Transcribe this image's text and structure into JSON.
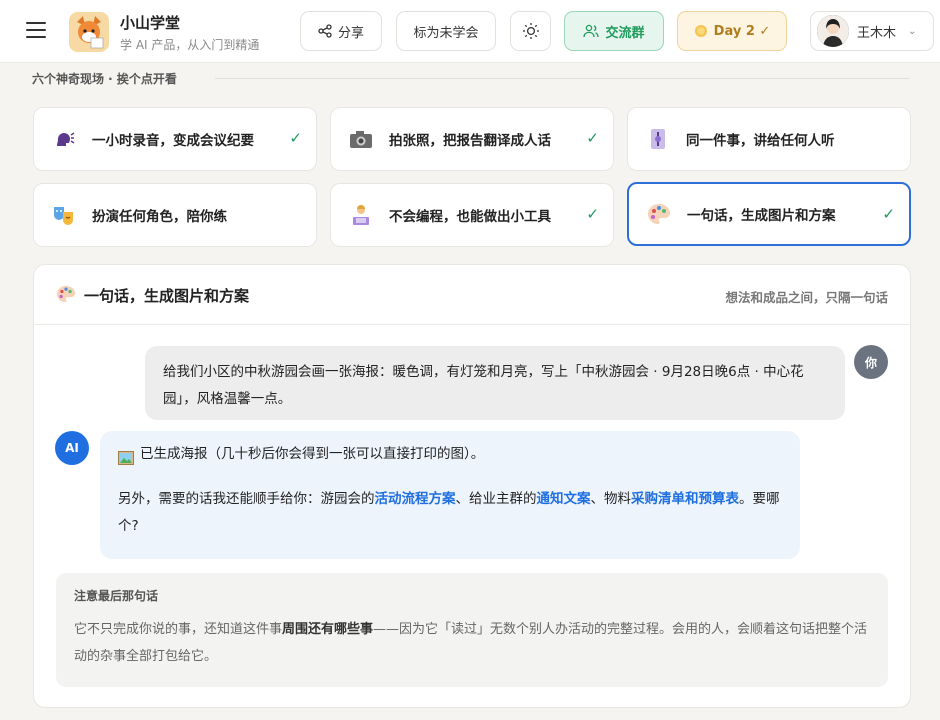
{
  "header": {
    "brand_title": "小山学堂",
    "brand_subtitle": "学 AI 产品，从入门到精通",
    "share_label": "分享",
    "mark_label": "标为未学会",
    "group_label": "交流群",
    "day_label": "Day 2 ✓",
    "user_name": "王木木",
    "colors": {
      "accent_green": "#1e9a5c",
      "accent_blue": "#1f6fe0",
      "day_gold": "#b07d1d"
    }
  },
  "section": {
    "label": "六个神奇现场 · 挨个点开看"
  },
  "cards": [
    {
      "label": "一小时录音，变成会议纪要",
      "icon": "speaking-head-icon",
      "done": "✓"
    },
    {
      "label": "拍张照，把报告翻译成人话",
      "icon": "camera-icon",
      "done": "✓"
    },
    {
      "label": "同一件事，讲给任何人听",
      "icon": "scroll-icon",
      "done": ""
    },
    {
      "label": "扮演任何角色，陪你练",
      "icon": "theater-masks-icon",
      "done": ""
    },
    {
      "label": "不会编程，也能做出小工具",
      "icon": "technologist-icon",
      "done": "✓"
    },
    {
      "label": "一句话，生成图片和方案",
      "icon": "palette-icon",
      "done": "✓",
      "selected": true
    }
  ],
  "panel": {
    "title": "一句话，生成图片和方案",
    "tagline": "想法和成品之间，只隔一句话",
    "user_badge": "你",
    "ai_badge": "AI",
    "user_message": "给我们小区的中秋游园会画一张海报：暖色调，有灯笼和月亮，写上「中秋游园会 · 9月28日晚6点 · 中心花园」，风格温馨一点。",
    "ai_line1": "已生成海报（几十秒后你会得到一张可以直接打印的图）。",
    "ai_line2_a": "另外，需要的话我还能顺手给你：游园会的",
    "ai_link_1": "活动流程方案",
    "ai_line2_b": "、给业主群的",
    "ai_link_2": "通知文案",
    "ai_line2_c": "、物料",
    "ai_link_3": "采购清单和预算表",
    "ai_line2_d": "。要哪个?",
    "note_title": "注意最后那句话",
    "note_a": "它不只完成你说的事，还知道这件事",
    "note_bold": "周围还有哪些事",
    "note_b": "——因为它「读过」无数个别人办活动的完整过程。会用的人，会顺着这句话把整个活动的杂事全部打包给它。"
  }
}
